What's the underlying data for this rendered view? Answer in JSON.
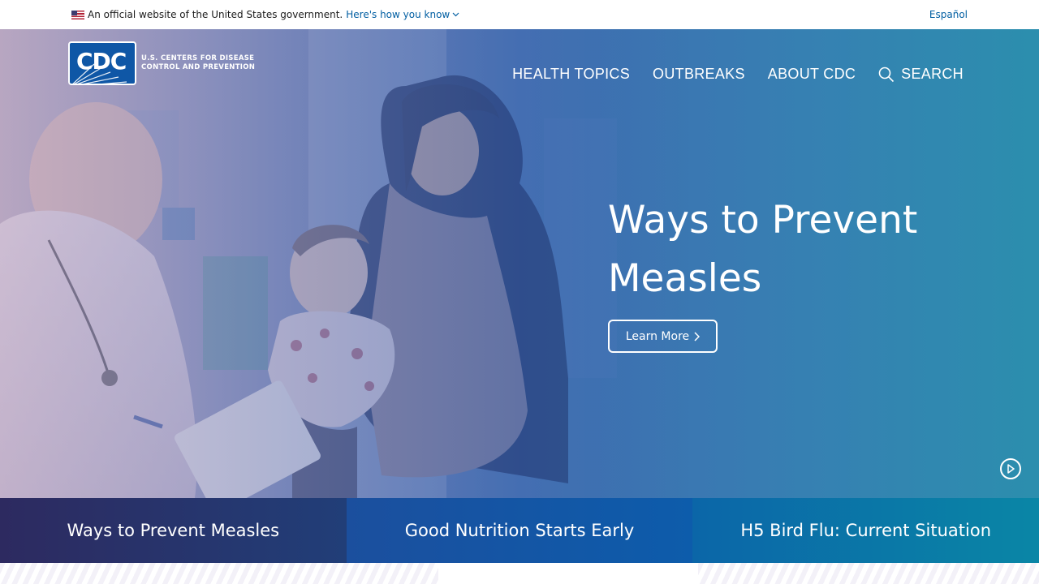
{
  "gov_banner": {
    "text": "An official website of the United States government.",
    "link": "Here's how you know",
    "language": "Español"
  },
  "logo": {
    "abbr": "CDC",
    "line1": "U.S. CENTERS FOR DISEASE",
    "line2": "CONTROL AND PREVENTION"
  },
  "nav": {
    "items": [
      "HEALTH TOPICS",
      "OUTBREAKS",
      "ABOUT CDC"
    ],
    "search": "SEARCH"
  },
  "hero": {
    "title": "Ways to Prevent Measles",
    "button": "Learn More"
  },
  "tabs": [
    {
      "label": "Ways to Prevent Measles"
    },
    {
      "label": "Good Nutrition Starts Early"
    },
    {
      "label": "H5 Bird Flu: Current Situation"
    }
  ]
}
